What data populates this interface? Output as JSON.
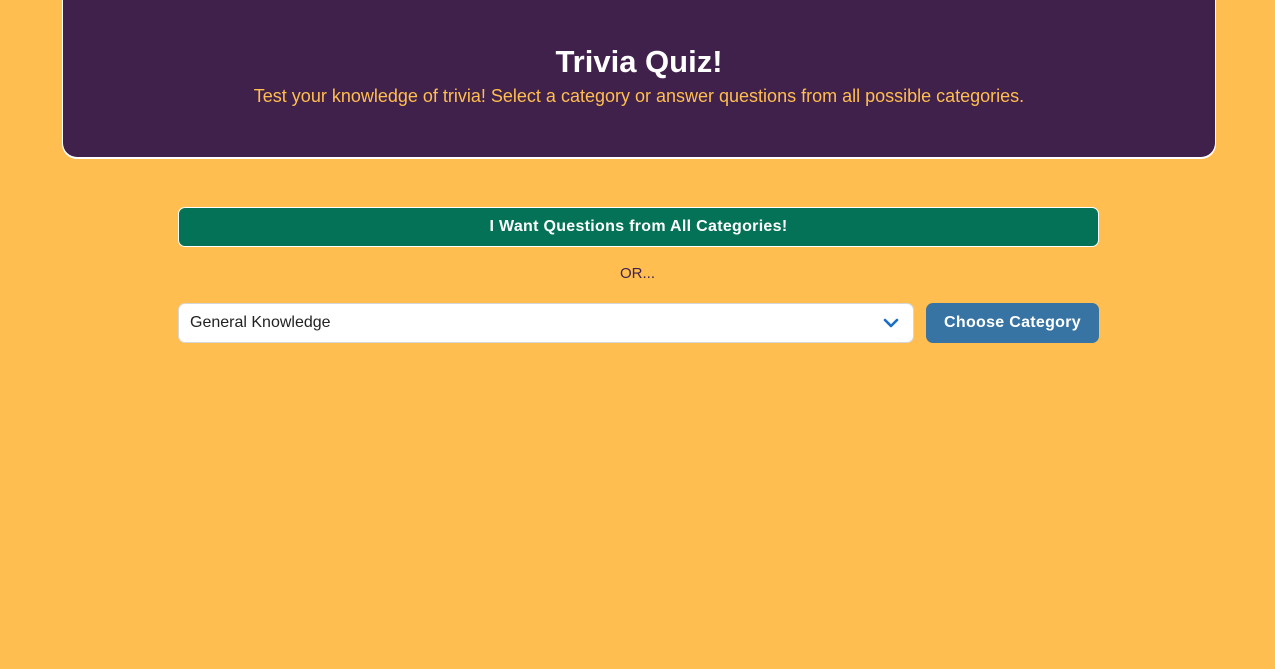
{
  "header": {
    "title": "Trivia Quiz!",
    "subtitle": "Test your knowledge of trivia! Select a category or answer questions from all possible categories."
  },
  "all_categories_button": {
    "label": "I Want Questions from All Categories!"
  },
  "separator": {
    "text": "OR..."
  },
  "category_select": {
    "selected": "General Knowledge",
    "icon": "chevron-down-icon"
  },
  "choose_button": {
    "label": "Choose Category"
  },
  "colors": {
    "background": "#ffbe4f",
    "header": "#40214c",
    "header_subtitle": "#ffbe4f",
    "all_button": "#037256",
    "choose_button": "#3774a4",
    "chevron": "#1a6fc4"
  }
}
